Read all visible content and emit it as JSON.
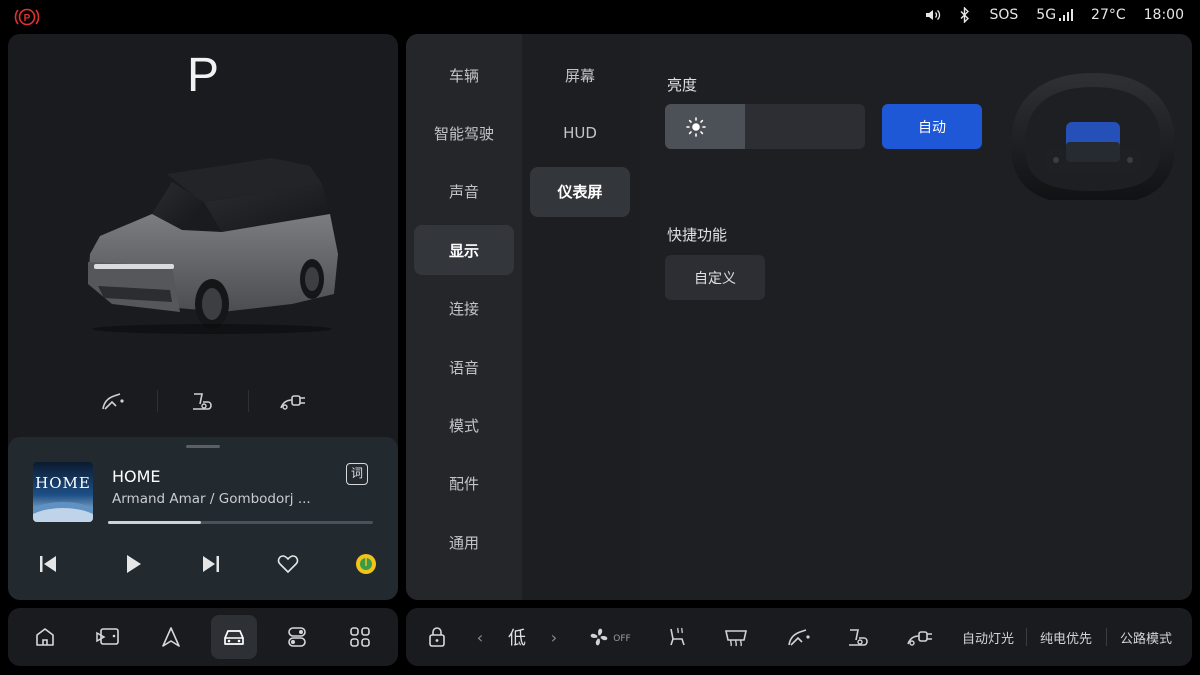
{
  "status_bar": {
    "sos": "SOS",
    "network": "5G",
    "temperature": "27°C",
    "time": "18:00",
    "icons": [
      "parking-brake-icon",
      "volume-icon",
      "bluetooth-icon",
      "signal-bars-icon"
    ]
  },
  "vehicle": {
    "gear": "P",
    "quick_icons": [
      "charge-port-icon",
      "tailgate-icon",
      "plug-icon"
    ]
  },
  "media": {
    "album_art_text": "HOME",
    "title": "HOME",
    "artist": "Armand Amar / Gombodorj ...",
    "lyrics_button": "词",
    "progress": 0.35,
    "controls": [
      "previous-icon",
      "play-icon",
      "next-icon",
      "heart-icon",
      "music-app-icon"
    ]
  },
  "settings": {
    "nav_primary": [
      {
        "label": "车辆",
        "active": false
      },
      {
        "label": "智能驾驶",
        "active": false
      },
      {
        "label": "声音",
        "active": false
      },
      {
        "label": "显示",
        "active": true
      },
      {
        "label": "连接",
        "active": false
      },
      {
        "label": "语音",
        "active": false
      },
      {
        "label": "模式",
        "active": false
      },
      {
        "label": "配件",
        "active": false
      },
      {
        "label": "通用",
        "active": false
      }
    ],
    "nav_secondary": [
      {
        "label": "屏幕",
        "active": false
      },
      {
        "label": "HUD",
        "active": false
      },
      {
        "label": "仪表屏",
        "active": true
      }
    ],
    "brightness": {
      "label": "亮度",
      "level": 0.4,
      "auto_label": "自动"
    },
    "shortcut": {
      "label": "快捷功能",
      "custom_label": "自定义"
    }
  },
  "dock_left": {
    "items": [
      "home-icon",
      "screen-cast-icon",
      "navigation-icon",
      "car-icon",
      "toggle-icon",
      "apps-grid-icon"
    ],
    "active": "car-icon"
  },
  "dock_right": {
    "fan_level": "低",
    "fan_state": "OFF",
    "auto_lights": "自动灯光",
    "ev_priority": "纯电优先",
    "road_mode": "公路模式"
  },
  "colors": {
    "accent": "#1f58d6",
    "panel": "#1a1b1e",
    "media_card": "#22292f",
    "parking_red": "#e0322f"
  }
}
